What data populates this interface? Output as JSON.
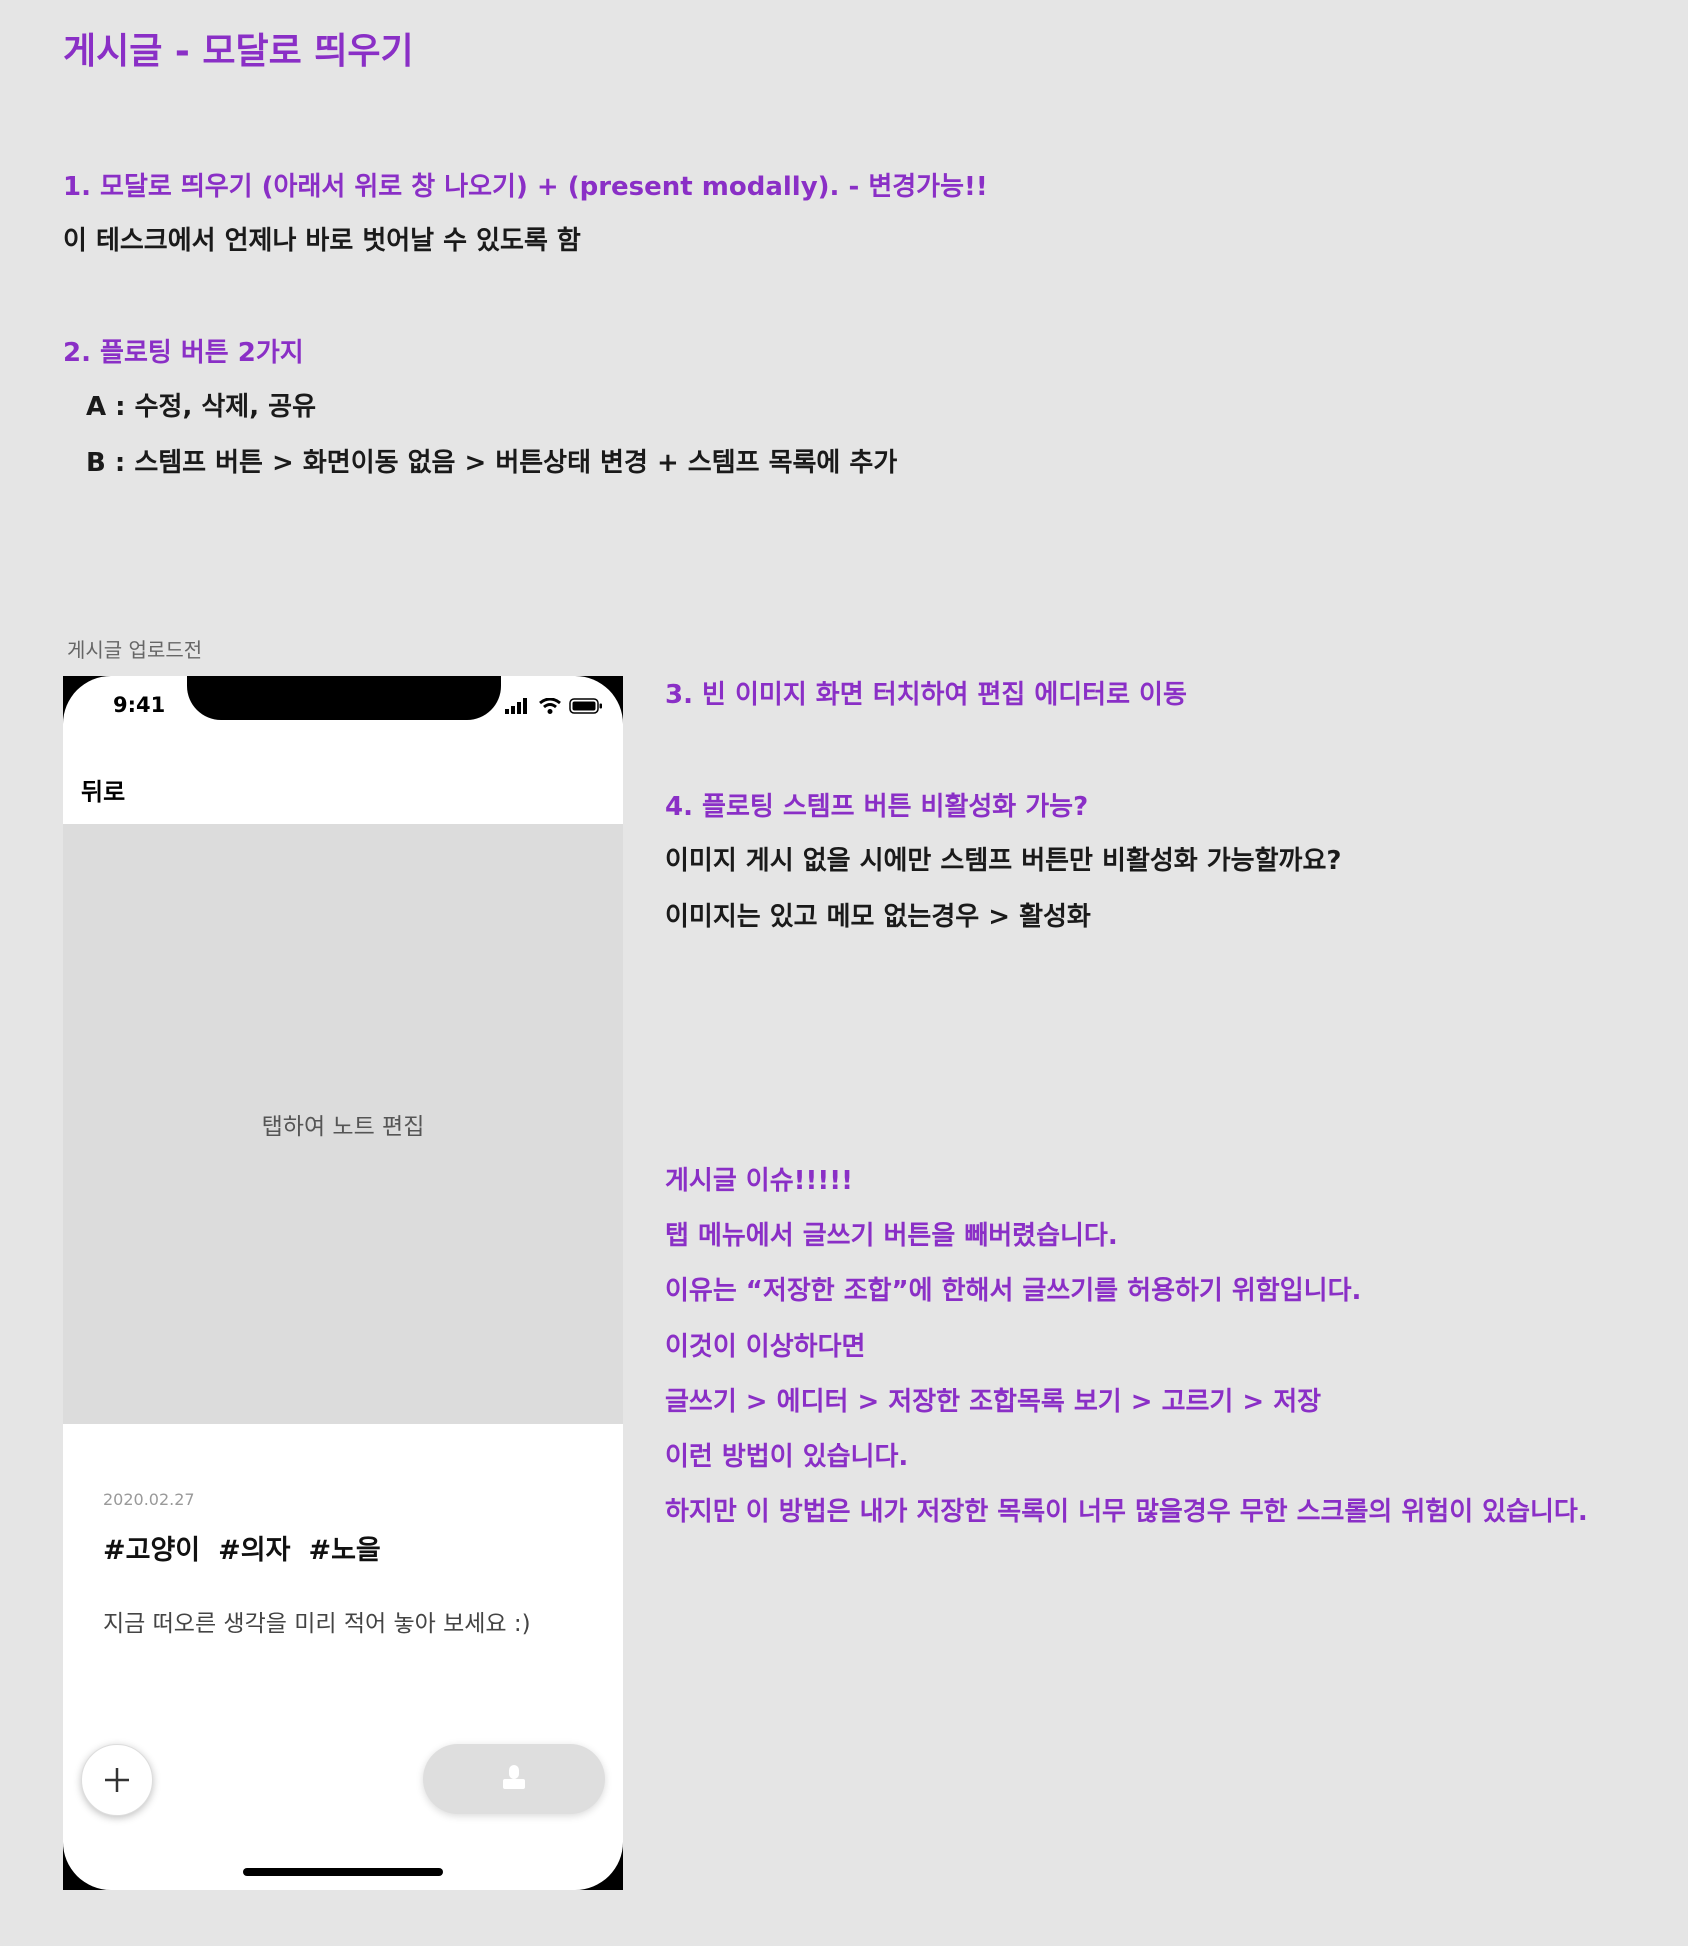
{
  "title": "게시글 - 모달로 띄우기",
  "section1": {
    "heading": "1. 모달로 띄우기 (아래서 위로 창 나오기) + (present modally). -  변경가능!!",
    "desc": "이 테스크에서 언제나 바로 벗어날 수 있도록 함"
  },
  "section2": {
    "heading": "2. 플로팅 버튼 2가지",
    "item_a": "A : 수정, 삭제, 공유",
    "item_b": "B : 스템프 버튼 > 화면이동 없음 > 버튼상태 변경 + 스템프 목록에 추가"
  },
  "phone": {
    "caption": "게시글 업로드전",
    "time": "9:41",
    "back_label": "뒤로",
    "image_hint": "탭하여 노트 편집",
    "date": "2020.02.27",
    "tags": [
      "#고양이",
      "#의자",
      "#노을"
    ],
    "memo_placeholder": "지금 떠오른 생각을 미리 적어 놓아 보세요 :)"
  },
  "section3": {
    "heading": "3. 빈 이미지 화면 터치하여 편집 에디터로 이동"
  },
  "section4": {
    "heading": "4. 플로팅 스템프 버튼 비활성화 가능?",
    "line1": "이미지 게시 없을 시에만 스템프 버튼만 비활성화 가능할까요?",
    "line2": "이미지는 있고 메모 없는경우 > 활성화"
  },
  "issue": {
    "lines": [
      "게시글 이슈!!!!!",
      "탭 메뉴에서 글쓰기 버튼을 빼버렸습니다.",
      "이유는 “저장한 조합”에 한해서 글쓰기를 허용하기 위함입니다.",
      "이것이 이상하다면",
      "글쓰기 > 에디터 > 저장한 조합목록 보기 > 고르기 > 저장",
      "이런 방법이 있습니다.",
      "하지만 이 방법은 내가 저장한 목록이 너무 많을경우 무한 스크롤의 위험이 있습니다."
    ]
  },
  "colors": {
    "accent": "#8a2fc6",
    "background": "#e5e5e5",
    "image_placeholder": "#dcdcdc"
  }
}
